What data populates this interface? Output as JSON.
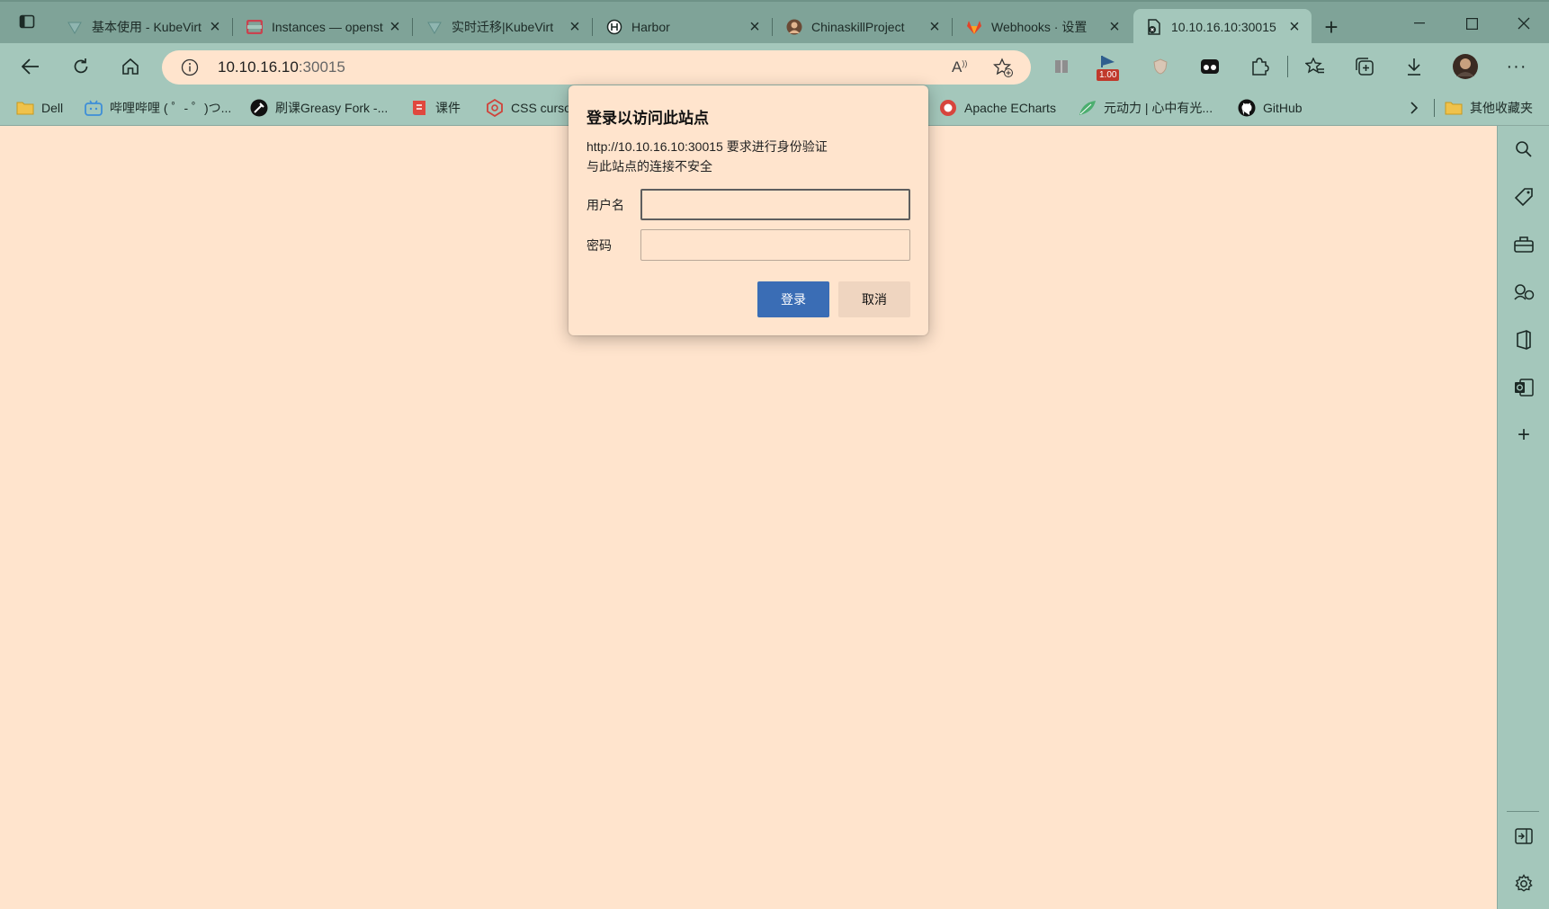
{
  "tabs": [
    {
      "title": "基本使用 - KubeVirt",
      "icon": "kubevirt-icon"
    },
    {
      "title": "Instances — openstack",
      "icon": "openstack-icon"
    },
    {
      "title": "实时迁移|KubeVirt",
      "icon": "kubevirt-icon"
    },
    {
      "title": "Harbor",
      "icon": "harbor-icon"
    },
    {
      "title": "ChinaskillProject",
      "icon": "avatar-icon"
    },
    {
      "title": "Webhooks · 设置",
      "icon": "gitlab-icon"
    },
    {
      "title": "10.10.16.10:30015",
      "icon": "page-error-icon"
    }
  ],
  "address": {
    "host": "10.10.16.10",
    "port": ":30015"
  },
  "extension_badge": "1.00",
  "bookmarks": [
    {
      "label": "Dell",
      "icon": "folder-icon"
    },
    {
      "label": "哔哩哔哩 ( ゜- ゜)つ...",
      "icon": "bilibili-icon"
    },
    {
      "label": "刷课Greasy Fork -...",
      "icon": "greasyfork-icon"
    },
    {
      "label": "课件",
      "icon": "book-icon"
    },
    {
      "label": "CSS cursor",
      "icon": "css-icon"
    },
    {
      "label": "Apache ECharts",
      "icon": "echarts-icon"
    },
    {
      "label": "元动力 | 心中有光...",
      "icon": "leaf-icon"
    },
    {
      "label": "GitHub",
      "icon": "github-icon"
    }
  ],
  "other_bookmarks": "其他收藏夹",
  "dialog": {
    "title": "登录以访问此站点",
    "message_line1": "http://10.10.16.10:30015 要求进行身份验证",
    "message_line2": "与此站点的连接不安全",
    "username_label": "用户名",
    "password_label": "密码",
    "login_label": "登录",
    "cancel_label": "取消"
  },
  "colors": {
    "chrome": "#a4c7bb",
    "page_bg": "#ffe4cd",
    "primary_button": "#3a6db5"
  }
}
